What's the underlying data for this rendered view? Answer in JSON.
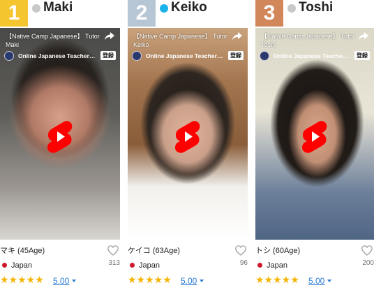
{
  "teachers": [
    {
      "rank": "1",
      "name": "Maki",
      "rank_color": "#f5c52f",
      "status_color": "#c8c8c8",
      "video": {
        "title": "【Native Camp Japanese】 Tutor Maki",
        "channel": "Online Japanese Teacher - Nati...",
        "subscribe": "登録"
      },
      "age": "マキ (45Age)",
      "likes": "313",
      "country": "Japan",
      "stars": "★★★★★",
      "rating": "5.00"
    },
    {
      "rank": "2",
      "name": "Keiko",
      "rank_color": "#b6c6d4",
      "status_color": "#1ab2e8",
      "video": {
        "title": "【Native Camp Japanese】 Tutor Keiko",
        "channel": "Online Japanese Teacher - Nati...",
        "subscribe": "登録"
      },
      "age": "ケイコ (63Age)",
      "likes": "96",
      "country": "Japan",
      "stars": "★★★★★",
      "rating": "5.00"
    },
    {
      "rank": "3",
      "name": "Toshi",
      "rank_color": "#d2875a",
      "status_color": "#c8c8c8",
      "video": {
        "title": "【Native Camp Japanese】 Tutor Toshi",
        "channel": "Online Japanese Teacher - Nati...",
        "subscribe": "登録"
      },
      "age": "トシ (60Age)",
      "likes": "200",
      "country": "Japan",
      "stars": "★★★★★",
      "rating": "5.00"
    }
  ],
  "icons": {
    "play": "youtube-shorts-play-icon",
    "share": "share-arrow-icon",
    "heart": "heart-outline-icon",
    "flag": "japan-flag-icon",
    "caret": "caret-down-icon"
  },
  "colors": {
    "star": "#f5b400",
    "rating_link": "#2a7bd4",
    "play_red": "#ff0000"
  }
}
